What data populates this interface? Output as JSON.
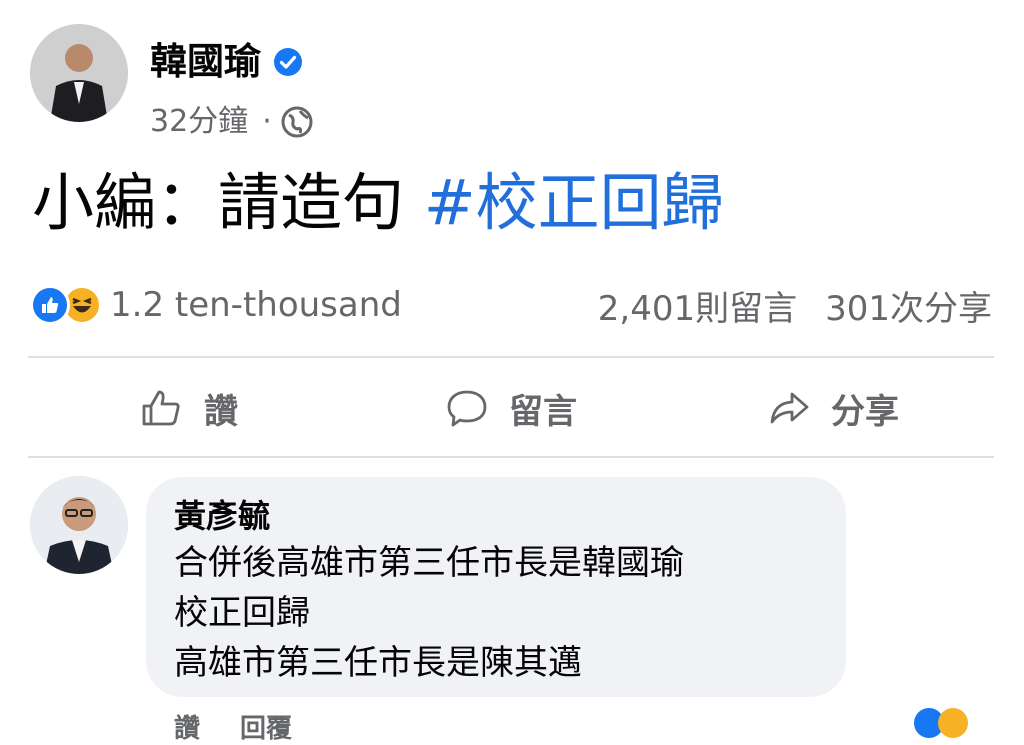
{
  "post": {
    "author": "韓國瑜",
    "time": "32分鐘",
    "separator": "·",
    "text": "小編：請造句",
    "hashtag": "#校正回歸"
  },
  "reactions": {
    "count": "1.2 ten-thousand",
    "comments": "2,401則留言",
    "shares": "301次分享",
    "icons": [
      "like-icon",
      "haha-icon"
    ],
    "like_color": "#1877f2",
    "haha_color": "#f7b125"
  },
  "actions": {
    "like": "讚",
    "comment": "留言",
    "share": "分享"
  },
  "comment": {
    "author": "黃彥毓",
    "lines": [
      "合併後高雄市第三任市長是韓國瑜",
      "校正回歸",
      "高雄市第三任市長是陳其邁"
    ],
    "like": "讚",
    "reply": "回覆"
  },
  "colors": {
    "accent": "#216fdb",
    "secondary_text": "#65676b",
    "bubble": "#f0f2f5"
  }
}
